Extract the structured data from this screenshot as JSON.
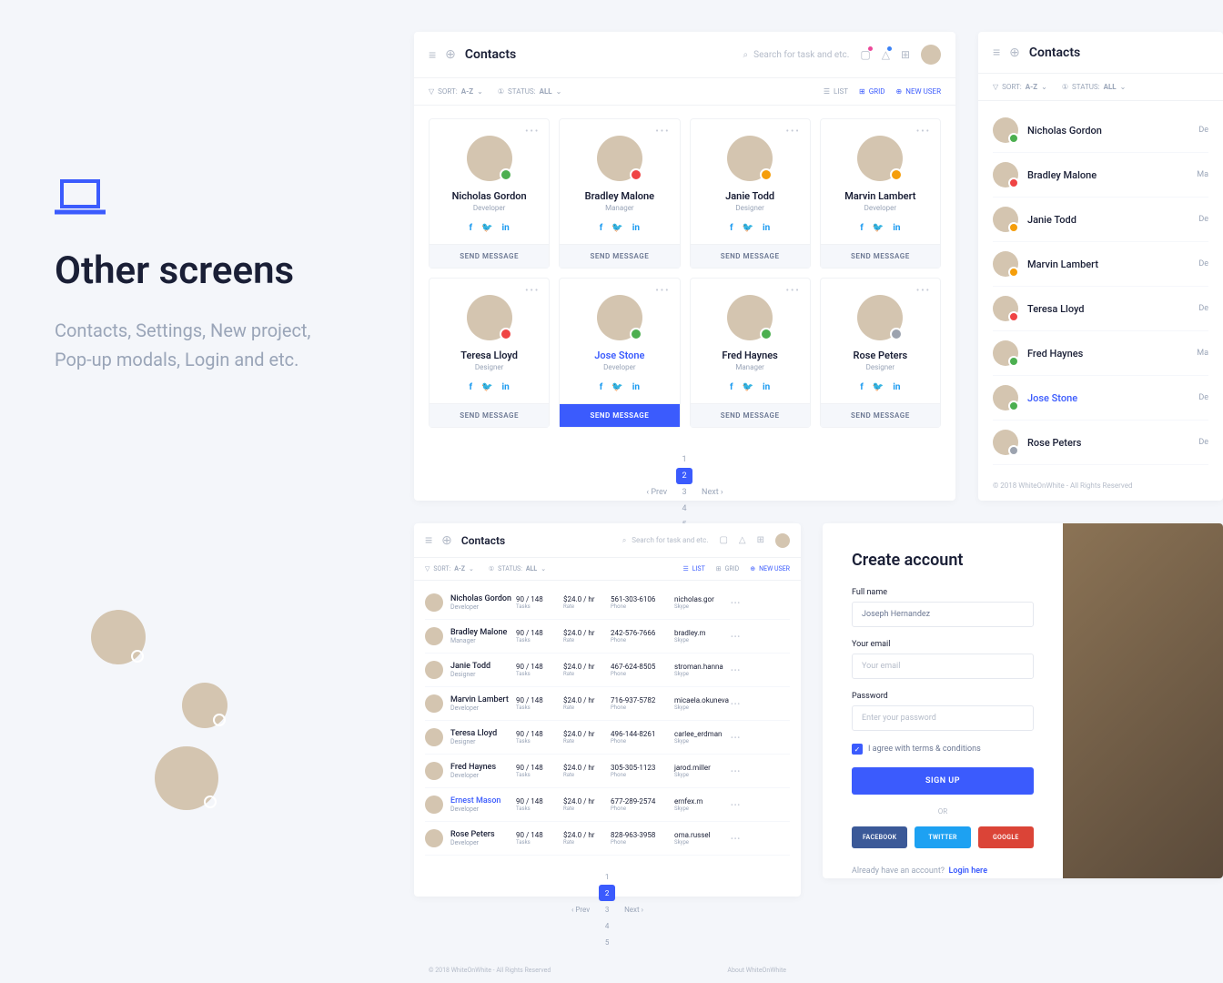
{
  "left": {
    "title": "Other screens",
    "desc": "Contacts, Settings, New project, Pop-up modals, Login and etc."
  },
  "header": {
    "title": "Contacts",
    "search_placeholder": "Search for task and etc."
  },
  "filters": {
    "sort_label": "SORT:",
    "sort_val": "A-Z",
    "status_label": "STATUS:",
    "status_val": "ALL",
    "list": "LIST",
    "grid": "GRID",
    "new_user": "NEW USER"
  },
  "contacts_grid": [
    {
      "name": "Nicholas Gordon",
      "role": "Developer",
      "status": "green",
      "active": false
    },
    {
      "name": "Bradley Malone",
      "role": "Manager",
      "status": "red",
      "active": false
    },
    {
      "name": "Janie Todd",
      "role": "Designer",
      "status": "orange",
      "active": false
    },
    {
      "name": "Marvin Lambert",
      "role": "Developer",
      "status": "orange",
      "active": false
    },
    {
      "name": "Teresa Lloyd",
      "role": "Designer",
      "status": "red",
      "active": false
    },
    {
      "name": "Jose Stone",
      "role": "Developer",
      "status": "green",
      "active": true
    },
    {
      "name": "Fred Haynes",
      "role": "Manager",
      "status": "green",
      "active": false
    },
    {
      "name": "Rose Peters",
      "role": "Designer",
      "status": "gray",
      "active": false
    }
  ],
  "send_message": "SEND MESSAGE",
  "pagination": {
    "prev": "Prev",
    "next": "Next",
    "pages": [
      "1",
      "2",
      "3",
      "4",
      "5"
    ],
    "current": "2"
  },
  "footer": {
    "left": "© 2018 WhiteOnWhite - All Rights Reserved",
    "right": "About WhiteOnWhite"
  },
  "contacts_list": [
    {
      "name": "Nicholas Gordon",
      "role": "De",
      "status": "green",
      "active": false
    },
    {
      "name": "Bradley Malone",
      "role": "Ma",
      "status": "red",
      "active": false
    },
    {
      "name": "Janie Todd",
      "role": "De",
      "status": "orange",
      "active": false
    },
    {
      "name": "Marvin Lambert",
      "role": "De",
      "status": "orange",
      "active": false
    },
    {
      "name": "Teresa Lloyd",
      "role": "De",
      "status": "red",
      "active": false
    },
    {
      "name": "Fred Haynes",
      "role": "Ma",
      "status": "green",
      "active": false
    },
    {
      "name": "Jose Stone",
      "role": "De",
      "status": "green",
      "active": true
    },
    {
      "name": "Rose Peters",
      "role": "De",
      "status": "gray",
      "active": false
    }
  ],
  "table_cols": {
    "tasks": "Tasks",
    "rate": "Rate",
    "phone": "Phone",
    "skype": "Skype"
  },
  "contacts_table": [
    {
      "name": "Nicholas Gordon",
      "role": "Developer",
      "tasks": "90 / 148",
      "rate": "$24.0 / hr",
      "phone": "561-303-6106",
      "skype": "nicholas.gor",
      "active": false
    },
    {
      "name": "Bradley Malone",
      "role": "Manager",
      "tasks": "90 / 148",
      "rate": "$24.0 / hr",
      "phone": "242-576-7666",
      "skype": "bradley.m",
      "active": false
    },
    {
      "name": "Janie Todd",
      "role": "Designer",
      "tasks": "90 / 148",
      "rate": "$24.0 / hr",
      "phone": "467-624-8505",
      "skype": "stroman.hanna",
      "active": false
    },
    {
      "name": "Marvin Lambert",
      "role": "Developer",
      "tasks": "90 / 148",
      "rate": "$24.0 / hr",
      "phone": "716-937-5782",
      "skype": "micaela.okuneva",
      "active": false
    },
    {
      "name": "Teresa Lloyd",
      "role": "Designer",
      "tasks": "90 / 148",
      "rate": "$24.0 / hr",
      "phone": "496-144-8261",
      "skype": "carlee_erdman",
      "active": false
    },
    {
      "name": "Fred Haynes",
      "role": "Developer",
      "tasks": "90 / 148",
      "rate": "$24.0 / hr",
      "phone": "305-305-1123",
      "skype": "jarod.miller",
      "active": false
    },
    {
      "name": "Ernest Mason",
      "role": "Developer",
      "tasks": "90 / 148",
      "rate": "$24.0 / hr",
      "phone": "677-289-2574",
      "skype": "ernfex.m",
      "active": true
    },
    {
      "name": "Rose Peters",
      "role": "Developer",
      "tasks": "90 / 148",
      "rate": "$24.0 / hr",
      "phone": "828-963-3958",
      "skype": "oma.russel",
      "active": false
    }
  ],
  "signup": {
    "title": "Create account",
    "full_name_label": "Full name",
    "full_name_val": "Joseph Hernandez",
    "email_label": "Your email",
    "email_ph": "Your email",
    "password_label": "Password",
    "password_ph": "Enter your password",
    "terms": "I agree with terms & conditions",
    "button": "SIGN UP",
    "or": "OR",
    "fb": "FACEBOOK",
    "tw": "TWITTER",
    "gg": "GOOGLE",
    "already": "Already have an account?",
    "login": "Login here"
  }
}
